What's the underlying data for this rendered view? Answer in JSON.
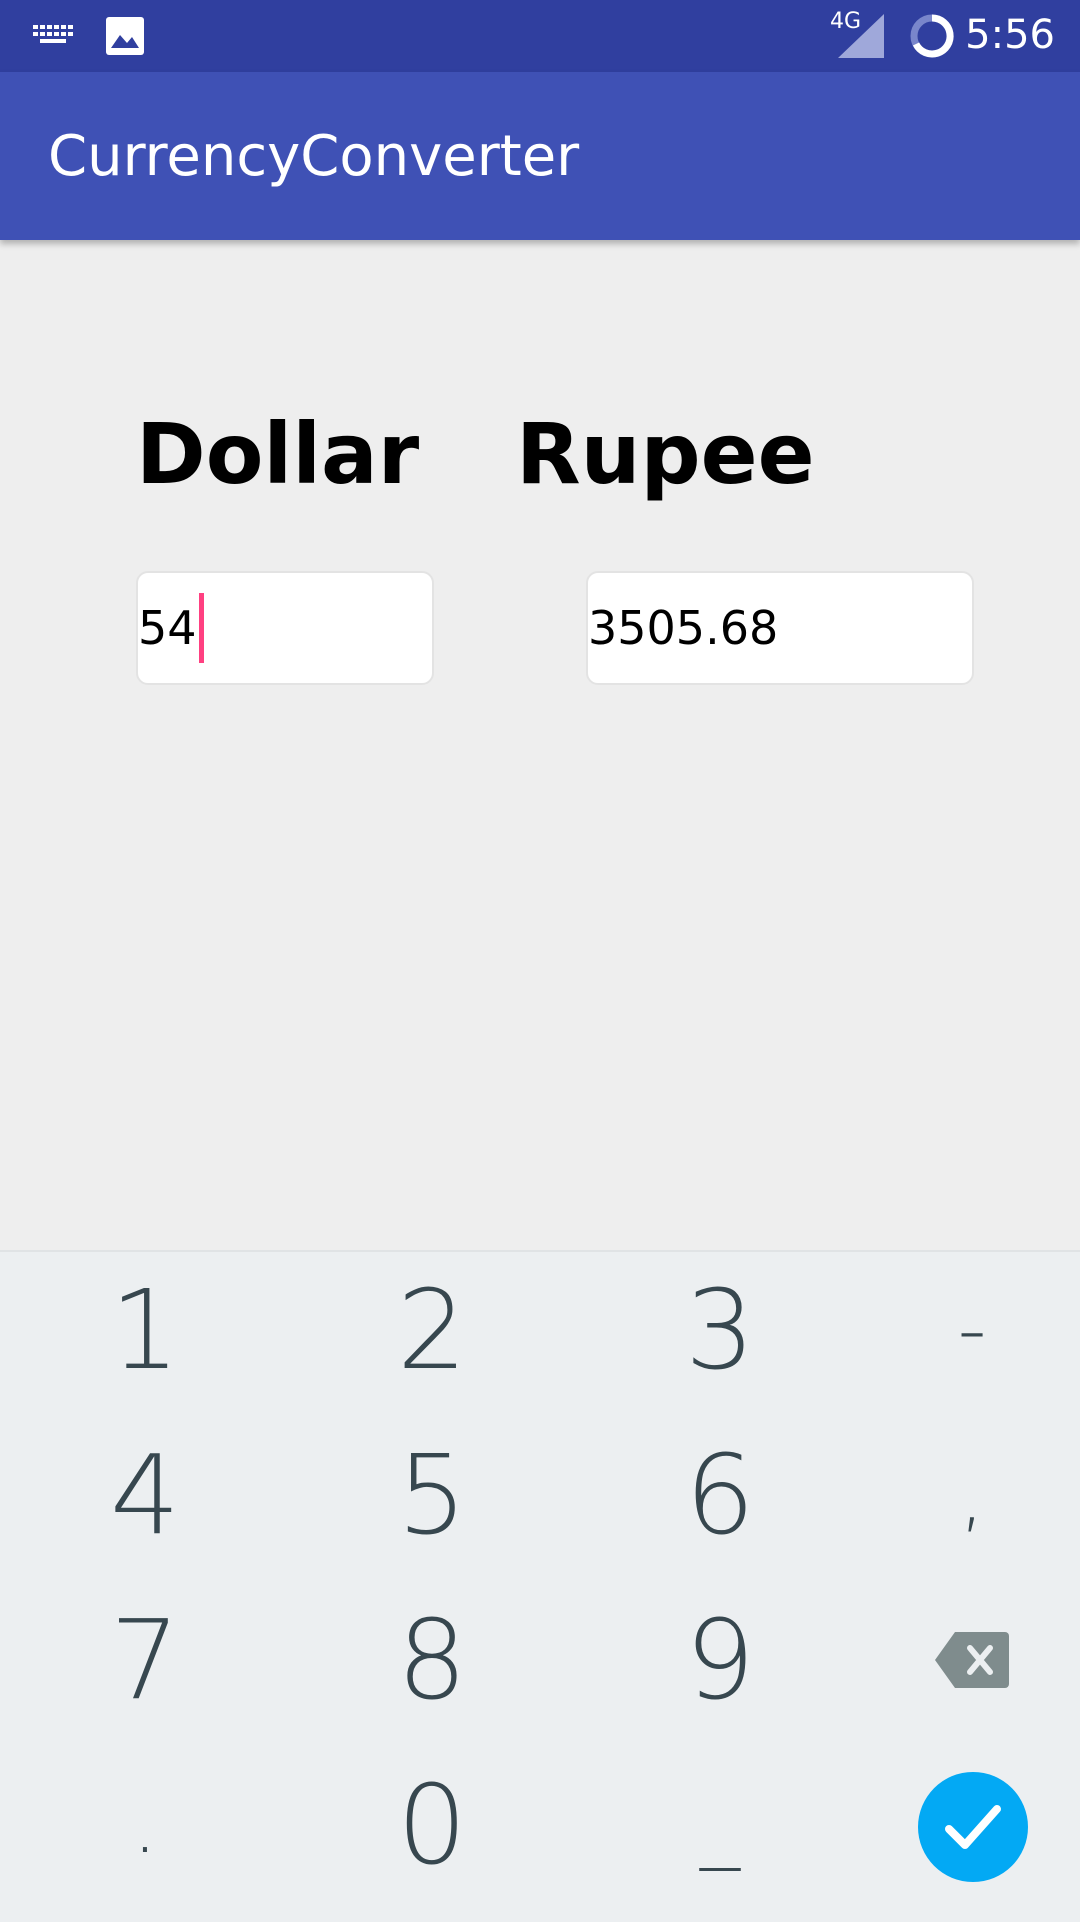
{
  "status_bar": {
    "network_type": "4G",
    "time": "5:56",
    "icons": [
      "keyboard-icon",
      "image-icon",
      "signal-icon",
      "battery-icon"
    ]
  },
  "app_bar": {
    "title": "CurrencyConverter",
    "color": "#3F51B5"
  },
  "converter": {
    "dollar_label": "Dollar",
    "rupee_label": "Rupee",
    "dollar_value": "54",
    "rupee_value": "3505.68"
  },
  "keyboard": {
    "row1": [
      "1",
      "2",
      "3",
      "-"
    ],
    "row2": [
      "4",
      "5",
      "6",
      ","
    ],
    "row3": [
      "7",
      "8",
      "9"
    ],
    "row4": [
      ".",
      "0",
      "_"
    ],
    "backspace_icon": "backspace-icon",
    "done_icon": "check-icon",
    "accent": "#03A9F4"
  }
}
